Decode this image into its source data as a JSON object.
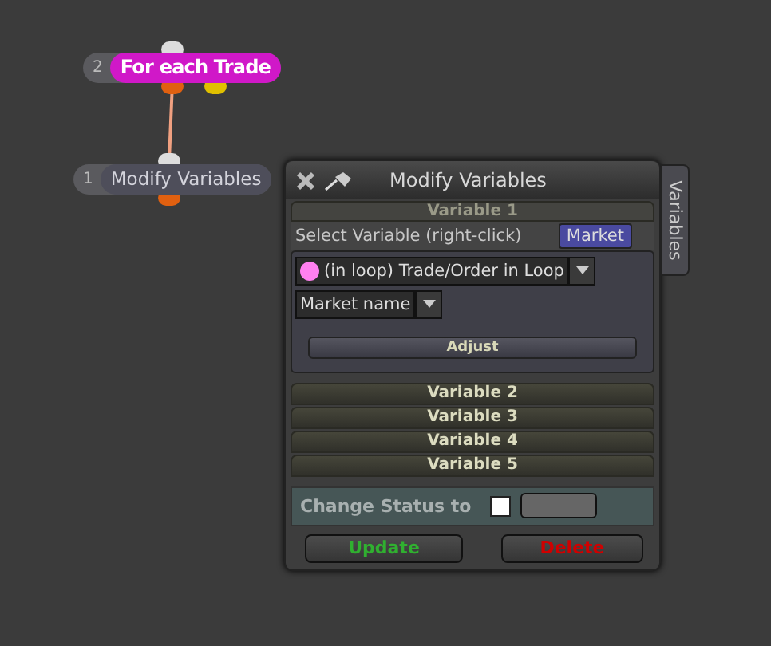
{
  "nodes": [
    {
      "number": "2",
      "label": "For each Trade",
      "selected": true
    },
    {
      "number": "1",
      "label": "Modify Variables",
      "selected": false
    }
  ],
  "panel": {
    "title": "Modify Variables",
    "side_tab": "Variables",
    "variables": [
      {
        "title": "Variable 1",
        "expanded": true,
        "select_label": "Select Variable (right-click)",
        "badge": "Market",
        "source": {
          "label": "(in loop) Trade/Order in Loop",
          "color": "#ff80f0"
        },
        "property": "Market name",
        "action": "Adjust"
      },
      {
        "title": "Variable 2",
        "expanded": false
      },
      {
        "title": "Variable 3",
        "expanded": false
      },
      {
        "title": "Variable 4",
        "expanded": false
      },
      {
        "title": "Variable 5",
        "expanded": false
      }
    ],
    "status": {
      "label": "Change Status to",
      "checked": false
    },
    "buttons": [
      {
        "label": "Update",
        "kind": "confirm"
      },
      {
        "label": "Delete",
        "kind": "danger"
      }
    ]
  }
}
